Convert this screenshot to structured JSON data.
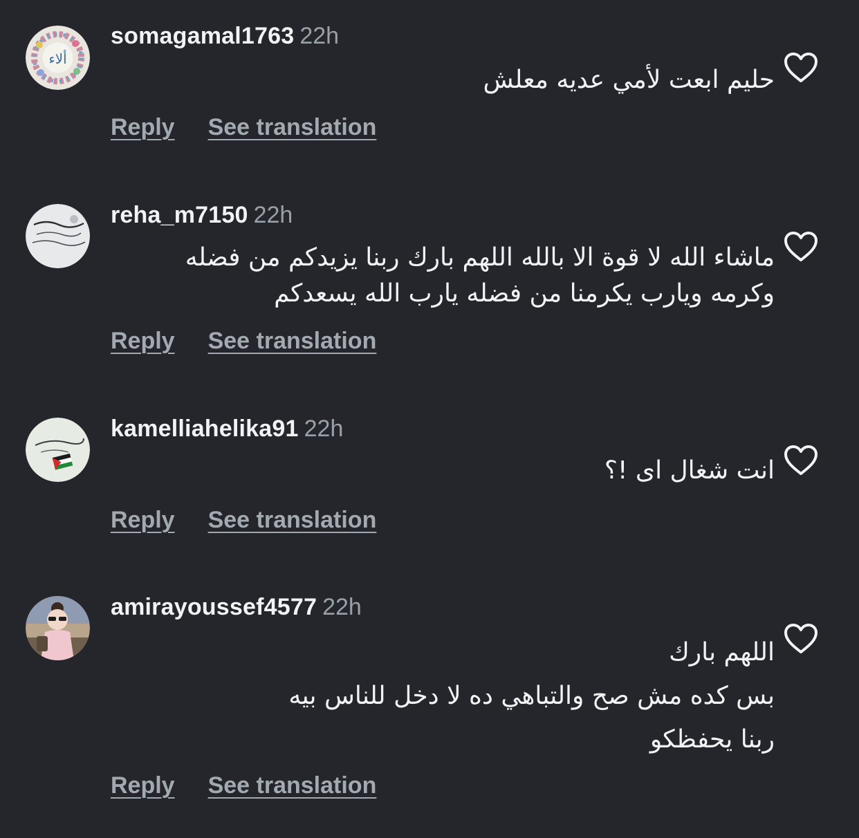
{
  "comments": [
    {
      "username": "somagamal1763",
      "time": "22h",
      "lines": [
        "حليم ابعت لأمي عديه معلش"
      ],
      "reply": "Reply",
      "translate": "See translation",
      "avatar_icon": "calligraphy-flower-wreath-avatar",
      "avatar_text": "ألاء"
    },
    {
      "username": "reha_m7150",
      "time": "22h",
      "lines": [
        "ماشاء الله لا قوة الا بالله اللهم بارك ربنا يزيدكم من فضله",
        "وكرمه ويارب يكرمنا من فضله يارب الله يسعدكم"
      ],
      "reply": "Reply",
      "translate": "See translation",
      "avatar_icon": "arabic-calligraphy-card-avatar"
    },
    {
      "username": "kamelliahelika91",
      "time": "22h",
      "lines": [
        "انت شغال اى !؟"
      ],
      "reply": "Reply",
      "translate": "See translation",
      "avatar_icon": "palestine-flag-note-avatar"
    },
    {
      "username": "amirayoussef4577",
      "time": "22h",
      "lines": [
        "اللهم بارك",
        "بس كده مش صح والتباهي ده لا دخل للناس بيه",
        "ربنا يحفظكو"
      ],
      "reply": "Reply",
      "translate": "See translation",
      "avatar_icon": "doll-girl-avatar"
    }
  ],
  "icons": {
    "like": "heart-outline-icon"
  },
  "colors": {
    "background": "#24262b",
    "text": "#f2f3f5",
    "muted": "#9aa0a8",
    "action": "#a3a9b1"
  }
}
